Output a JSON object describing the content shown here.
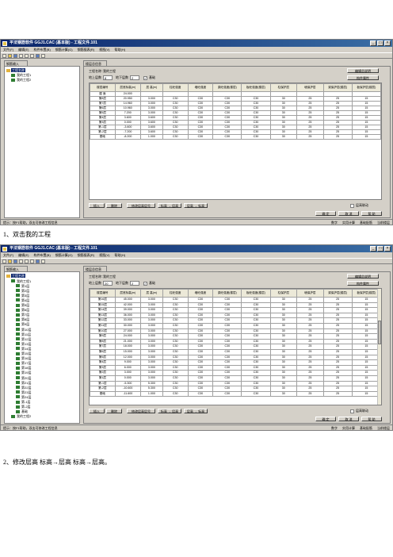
{
  "screens": [
    {
      "title": "平法钢筋软件 GGJ1.CAC (基本版) - 工程文件.101",
      "menu": [
        "文件(F)",
        "编辑(E)",
        "构件布置(B)",
        "钢筋计算(G)",
        "钢筋报表(R)",
        "视图(V)",
        "帮助(H)"
      ],
      "left_tab": "钢筋输入",
      "tree": [
        {
          "label": "工程名称",
          "level": 0,
          "selected": true
        },
        {
          "label": "我的工程1",
          "level": 1
        },
        {
          "label": "我的工程2",
          "level": 1
        }
      ],
      "dialog": {
        "tab": "楼层总信息",
        "project_label": "工程名称：",
        "project_name": "我的工程",
        "above_label": "地上层数",
        "above_value": "8",
        "below_label": "地下层数",
        "below_value": "2",
        "checkbox_label": "基础",
        "top_right_button": "编辑总说明",
        "right_button": "构件属性",
        "columns": [
          "楼层编号",
          "层底标高(m)",
          "层 高(m)",
          "柱砼强度",
          "墙砼强度",
          "梁砼强度(楼层)",
          "板砼强度(楼层)",
          "柱保护层",
          "墙保护层",
          "梁保护层(楼层)",
          "板保护层(楼层)"
        ],
        "rows": [
          [
            "屋 面",
            "24.000",
            "",
            "",
            "",
            "",
            "",
            "",
            "",
            "",
            ""
          ],
          [
            "第8层",
            "20.950",
            "3.000",
            "C30",
            "C30",
            "C30",
            "C30",
            "30",
            "25",
            "25",
            "15"
          ],
          [
            "第7层",
            "14.960",
            "3.000",
            "C30",
            "C30",
            "C30",
            "C30",
            "30",
            "25",
            "25",
            "15"
          ],
          [
            "第6层",
            "10.960",
            "3.000",
            "C30",
            "C30",
            "C30",
            "C30",
            "30",
            "25",
            "25",
            "15"
          ],
          [
            "第5层",
            "7.200",
            "3.000",
            "C30",
            "C30",
            "C30",
            "C30",
            "30",
            "25",
            "25",
            "15"
          ],
          [
            "第4层",
            "3.600",
            "3.600",
            "C30",
            "C30",
            "C30",
            "C30",
            "30",
            "25",
            "25",
            "15"
          ],
          [
            "第3层",
            "0.000",
            "3.600",
            "C30",
            "C30",
            "C30",
            "C30",
            "30",
            "25",
            "25",
            "15"
          ],
          [
            "第-1层",
            "-3.600",
            "3.600",
            "C30",
            "C30",
            "C30",
            "C30",
            "30",
            "25",
            "25",
            "15"
          ],
          [
            "第-2层",
            "-7.200",
            "3.600",
            "C30",
            "C30",
            "C30",
            "C30",
            "30",
            "25",
            "25",
            "15"
          ],
          [
            "基础",
            "-8.200",
            "1.000",
            "C30",
            "C30",
            "C30",
            "C30",
            "30",
            "25",
            "25",
            "15"
          ]
        ],
        "bottom_buttons": [
          "插入",
          "删除",
          "修改层高层号",
          "标高 → 层高",
          "层高 → 标高"
        ],
        "option_label": "层高联动",
        "ok": "确 定",
        "cancel": "取 消",
        "help": "帮 助"
      },
      "status_left": "提示：按F1帮助，双击可修改工程信息",
      "status_right": [
        "数字",
        "实用计算",
        "基础配筋",
        "当前楼层"
      ]
    },
    {
      "title": "平法钢筋软件 GGJ1.CAC (基本版) - 工程文件.101",
      "menu": [
        "文件(F)",
        "编辑(E)",
        "构件布置(B)",
        "钢筋计算(G)",
        "钢筋报表(R)",
        "视图(V)",
        "帮助(H)"
      ],
      "left_tab": "钢筋输入",
      "tree": [
        {
          "label": "工程名称",
          "level": 0,
          "selected": true
        },
        {
          "label": "我的工程1",
          "level": 1
        },
        {
          "label": "第1层",
          "level": 2
        },
        {
          "label": "第2层",
          "level": 2
        },
        {
          "label": "第3层",
          "level": 2
        },
        {
          "label": "第4层",
          "level": 2
        },
        {
          "label": "第5层",
          "level": 2
        },
        {
          "label": "第6层",
          "level": 2
        },
        {
          "label": "第7层",
          "level": 2
        },
        {
          "label": "第8层",
          "level": 2
        },
        {
          "label": "第9层",
          "level": 2
        },
        {
          "label": "第10层",
          "level": 2
        },
        {
          "label": "第11层",
          "level": 2
        },
        {
          "label": "第12层",
          "level": 2
        },
        {
          "label": "第13层",
          "level": 2
        },
        {
          "label": "第14层",
          "level": 2
        },
        {
          "label": "第15层",
          "level": 2
        },
        {
          "label": "第16层",
          "level": 2
        },
        {
          "label": "第17层",
          "level": 2
        },
        {
          "label": "第18层",
          "level": 2
        },
        {
          "label": "第19层",
          "level": 2
        },
        {
          "label": "第20层",
          "level": 2
        },
        {
          "label": "第21层",
          "level": 2
        },
        {
          "label": "第22层",
          "level": 2
        },
        {
          "label": "第23层",
          "level": 2
        },
        {
          "label": "第24层",
          "level": 2
        },
        {
          "label": "第-1层",
          "level": 2
        },
        {
          "label": "第-2层",
          "level": 2
        },
        {
          "label": "基础",
          "level": 2
        },
        {
          "label": "我的工程2",
          "level": 1
        }
      ],
      "dialog": {
        "tab": "楼层总信息",
        "project_label": "工程名称：",
        "project_name": "我的工程",
        "above_label": "地上层数",
        "above_value": "20",
        "below_label": "地下层数",
        "below_value": "2",
        "checkbox_label": "基础",
        "top_right_button": "编辑总说明",
        "right_button": "构件属性",
        "columns": [
          "楼层编号",
          "层底标高(m)",
          "层 高(m)",
          "柱砼强度",
          "墙砼强度",
          "梁砼强度(楼层)",
          "板砼强度(楼层)",
          "柱保护层",
          "墙保护层",
          "梁保护层(楼层)",
          "板保护层(楼层)"
        ],
        "rows": [
          [
            "第16层",
            "45.000",
            "3.000",
            "C30",
            "C30",
            "C30",
            "C30",
            "30",
            "25",
            "25",
            "15"
          ],
          [
            "第15层",
            "42.000",
            "3.000",
            "C30",
            "C30",
            "C30",
            "C30",
            "30",
            "25",
            "25",
            "15"
          ],
          [
            "第14层",
            "39.000",
            "3.000",
            "C30",
            "C30",
            "C30",
            "C30",
            "30",
            "25",
            "25",
            "15"
          ],
          [
            "第13层",
            "36.000",
            "3.000",
            "C30",
            "C30",
            "C30",
            "C30",
            "30",
            "25",
            "25",
            "15"
          ],
          [
            "第12层",
            "33.000",
            "3.000",
            "C30",
            "C30",
            "C30",
            "C30",
            "30",
            "25",
            "25",
            "15"
          ],
          [
            "第11层",
            "30.000",
            "3.000",
            "C30",
            "C30",
            "C30",
            "C30",
            "30",
            "25",
            "25",
            "15"
          ],
          [
            "第10层",
            "27.000",
            "3.000",
            "C30",
            "C30",
            "C30",
            "C30",
            "30",
            "25",
            "25",
            "15"
          ],
          [
            "第9层",
            "24.000",
            "3.000",
            "C30",
            "C30",
            "C30",
            "C30",
            "30",
            "25",
            "25",
            "15"
          ],
          [
            "第8层",
            "21.000",
            "3.000",
            "C30",
            "C30",
            "C30",
            "C30",
            "30",
            "25",
            "25",
            "15"
          ],
          [
            "第7层",
            "18.000",
            "3.000",
            "C30",
            "C30",
            "C30",
            "C30",
            "30",
            "25",
            "25",
            "15"
          ],
          [
            "第6层",
            "15.000",
            "3.000",
            "C30",
            "C30",
            "C30",
            "C30",
            "30",
            "25",
            "25",
            "15"
          ],
          [
            "第5层",
            "12.000",
            "3.000",
            "C30",
            "C30",
            "C30",
            "C30",
            "30",
            "25",
            "25",
            "15"
          ],
          [
            "第4层",
            "9.000",
            "3.000",
            "C30",
            "C30",
            "C30",
            "C30",
            "30",
            "25",
            "25",
            "15"
          ],
          [
            "第3层",
            "6.000",
            "3.000",
            "C30",
            "C30",
            "C30",
            "C30",
            "30",
            "25",
            "25",
            "15"
          ],
          [
            "第2层",
            "3.000",
            "3.000",
            "C30",
            "C30",
            "C30",
            "C30",
            "30",
            "25",
            "25",
            "15"
          ],
          [
            "第1层",
            "0.000",
            "3.000",
            "C30",
            "C30",
            "C30",
            "C30",
            "30",
            "25",
            "25",
            "15"
          ],
          [
            "第-1层",
            "-5.300",
            "5.300",
            "C30",
            "C30",
            "C30",
            "C30",
            "30",
            "25",
            "25",
            "15"
          ],
          [
            "第-2层",
            "-10.600",
            "5.300",
            "C30",
            "C30",
            "C30",
            "C30",
            "30",
            "25",
            "25",
            "15"
          ],
          [
            "基础",
            "-11.600",
            "1.000",
            "C30",
            "C30",
            "C30",
            "C30",
            "30",
            "25",
            "25",
            "15"
          ]
        ],
        "bottom_buttons": [
          "插入",
          "删除",
          "修改层高层号",
          "标高 → 层高",
          "层高 → 标高"
        ],
        "option_label": "层高联动",
        "ok": "确 定",
        "cancel": "取 消",
        "help": "帮 助"
      },
      "status_left": "提示：按F1帮助，双击可修改工程信息",
      "status_right": [
        "数字",
        "实用计算",
        "基础配筋",
        "当前楼层"
      ]
    }
  ],
  "captions": [
    "1、双击我的工程",
    "2、修改层高 标高→层高 标高→层高。"
  ]
}
